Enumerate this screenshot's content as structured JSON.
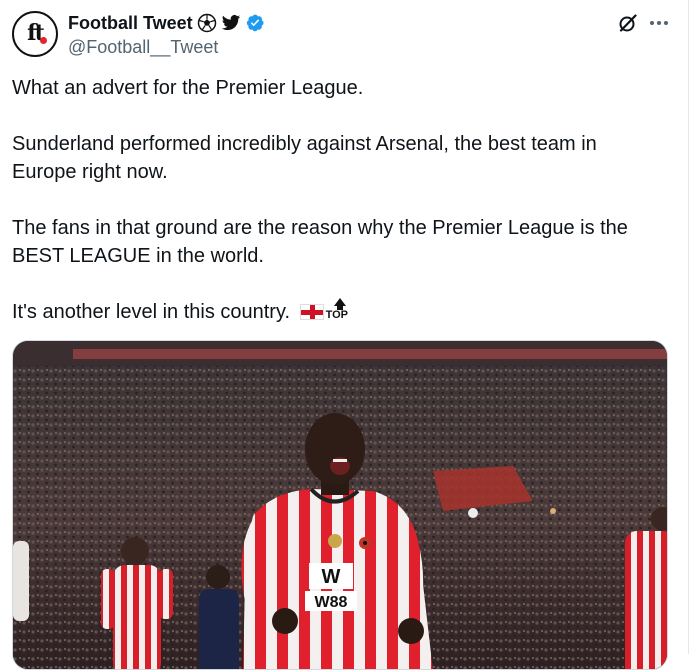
{
  "tweet": {
    "author": {
      "display_name": "Football Tweet",
      "handle": "@Football__Tweet",
      "avatar_letters": "ft",
      "verified": true
    },
    "paragraphs": [
      "What an advert for the Premier League.",
      "Sunderland performed incredibly against Arsenal, the best team in Europe right now.",
      "The fans in that ground are the reason why the Premier League is the BEST LEAGUE in the world."
    ],
    "last_line": "It's another level in this country.",
    "top_emoji_label": "TOP",
    "media": {
      "shirt_text": "W88"
    }
  },
  "icons": {
    "name_icons": [
      "soccer-ball-icon",
      "bird-icon",
      "verified-badge-icon"
    ],
    "header_actions": [
      "grok-icon",
      "more-icon"
    ]
  },
  "colors": {
    "verified_blue": "#1d9bf0",
    "handle_gray": "#536471",
    "text": "#0f1419",
    "flag_red": "#ce1124"
  }
}
